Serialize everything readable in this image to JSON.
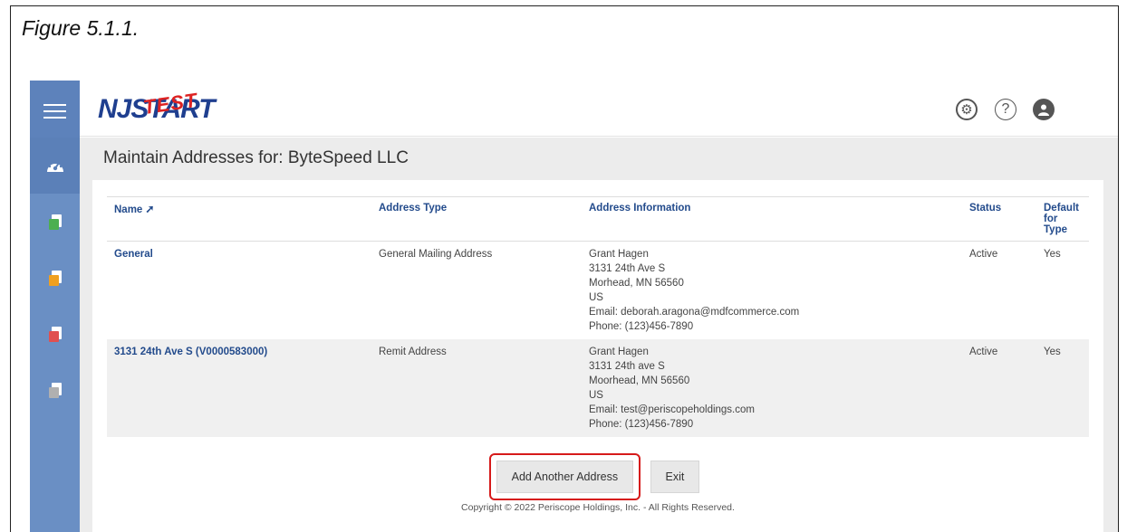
{
  "figure_caption": "Figure 5.1.1.",
  "brand": {
    "logo_nj": "NJ",
    "logo_start": "START",
    "logo_overlay": "TEST"
  },
  "header_icons": [
    "gear-icon",
    "help-icon",
    "user-icon"
  ],
  "sidebar": {
    "items": [
      {
        "name": "dashboard-icon",
        "color": "#ffffff"
      },
      {
        "name": "document-green-icon",
        "color": "#4caf50"
      },
      {
        "name": "document-orange-icon",
        "color": "#f0a020"
      },
      {
        "name": "document-red-icon",
        "color": "#e05050"
      },
      {
        "name": "document-gray-icon",
        "color": "#b0b0b0"
      }
    ]
  },
  "page": {
    "title": "Maintain Addresses for:  ByteSpeed LLC"
  },
  "table": {
    "columns": [
      "Name",
      "Address Type",
      "Address Information",
      "Status",
      "Default for Type"
    ],
    "rows": [
      {
        "name": "General",
        "address_type": "General Mailing Address",
        "address_lines": [
          "Grant Hagen",
          "3131 24th Ave S",
          "Morhead, MN 56560",
          "US",
          "Email: deborah.aragona@mdfcommerce.com",
          "Phone: (123)456-7890"
        ],
        "status": "Active",
        "default": "Yes"
      },
      {
        "name": "3131 24th Ave S (V0000583000)",
        "address_type": "Remit Address",
        "address_lines": [
          "Grant Hagen",
          "3131 24th ave S",
          "Moorhead, MN 56560",
          "US",
          "Email: test@periscopeholdings.com",
          "Phone: (123)456-7890"
        ],
        "status": "Active",
        "default": "Yes"
      }
    ]
  },
  "buttons": {
    "add": "Add Another Address",
    "exit": "Exit"
  },
  "footer": {
    "copyright": "Copyright © 2022 Periscope Holdings, Inc. - All Rights Reserved."
  },
  "colors": {
    "rail": "#6a8fc4",
    "link": "#234b8c",
    "highlight": "#d61a1a"
  }
}
